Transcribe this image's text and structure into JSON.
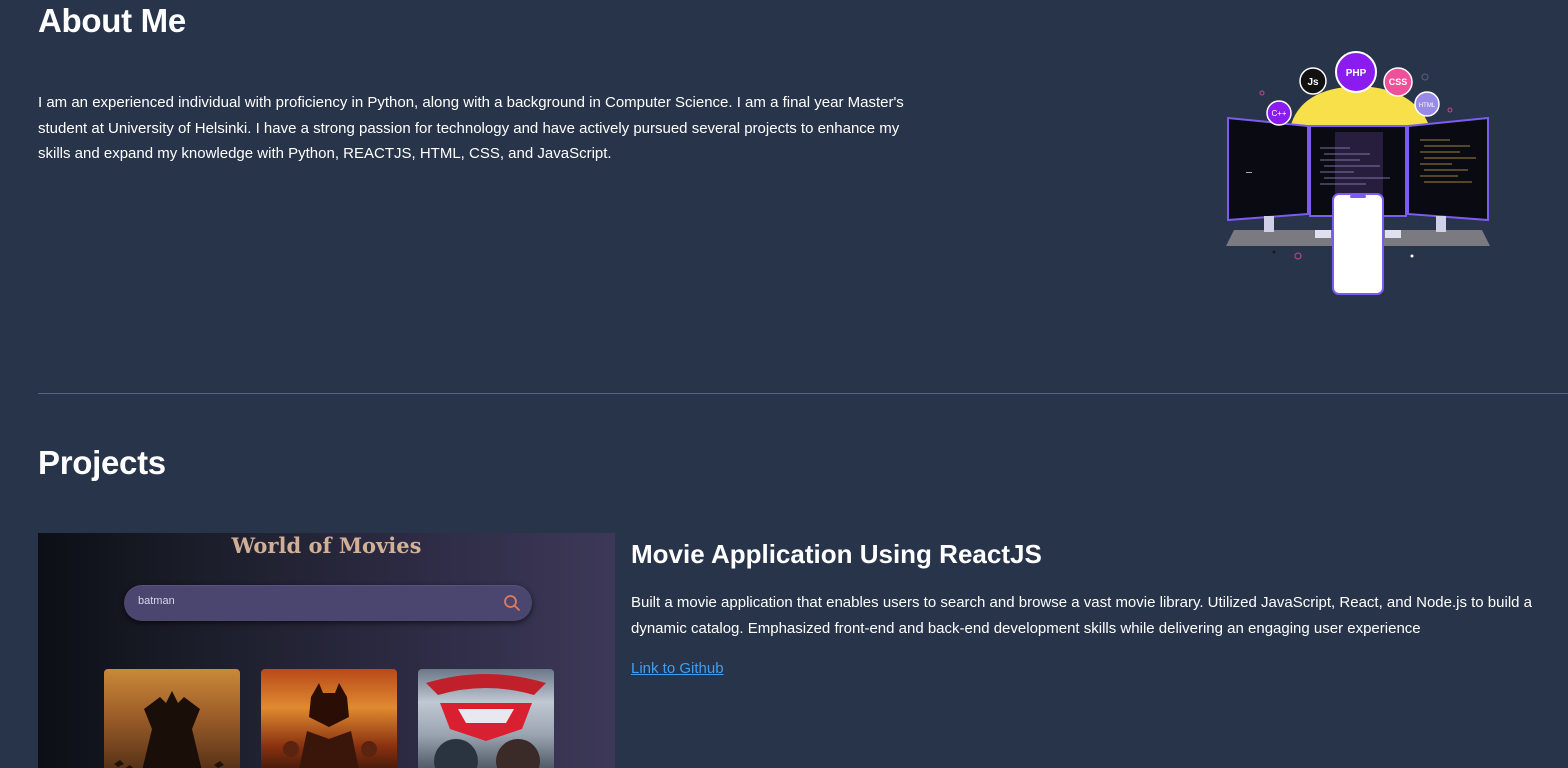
{
  "about": {
    "title": "About Me",
    "text": "I am an experienced individual with proficiency in Python, along with a background in Computer Science. I am a final year Master's student at University of Helsinki. I have a strong passion for technology and have actively pursued several projects to enhance my skills and expand my knowledge with Python, REACTJS, HTML, CSS, and JavaScript.",
    "illustration_badges": [
      "C++",
      "Js",
      "PHP",
      "CSS",
      "HTML"
    ]
  },
  "projects": {
    "title": "Projects",
    "items": [
      {
        "thumbnail": {
          "heading": "World of Movies",
          "search_value": "batman",
          "search_icon": "search-icon"
        },
        "title": "Movie Application Using ReactJS",
        "description": "Built a movie application that enables users to search and browse a vast movie library. Utilized JavaScript, React, and Node.js to build a dynamic catalog. Emphasized front-end and back-end development skills while delivering an engaging user experience",
        "link_label": "Link to Github"
      }
    ]
  },
  "colors": {
    "background": "#283449",
    "text": "#ffffff",
    "link": "#3ea0f5",
    "divider": "#58627a"
  }
}
